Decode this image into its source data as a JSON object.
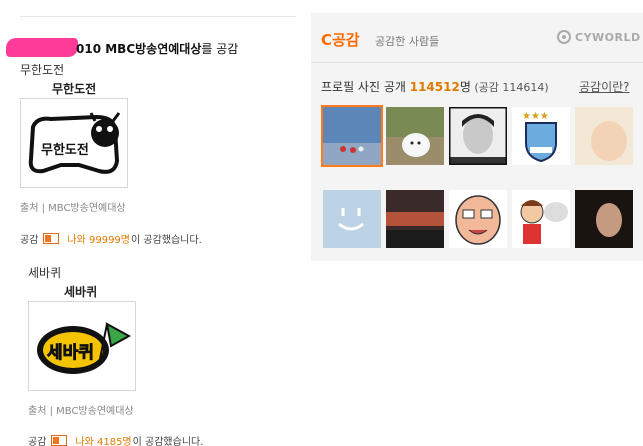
{
  "left": {
    "header_text": "010 MBC방송연예대상",
    "header_suffix": "를 공감",
    "items": [
      {
        "title": "무한도전",
        "thumb_title": "무한도전",
        "thumb_text": "무한도전",
        "source": "출처 | MBC방송연예대상",
        "empathy_label": "공감",
        "empathy_count": "나와 99999명",
        "empathy_suffix": "이 공감했습니다."
      },
      {
        "title": "세바퀴",
        "thumb_title": "세바퀴",
        "thumb_text": "세바퀴",
        "source": "출처 | MBC방송연예대상",
        "empathy_label": "공감",
        "empathy_count": "나와 4185명",
        "empathy_suffix": "이 공감했습니다."
      }
    ]
  },
  "right": {
    "title": "C공감",
    "subtitle": "공감한 사람들",
    "logo_text": "CYWORLD",
    "stats_prefix": "프로필 사진 공개 ",
    "stats_count": "114512",
    "stats_unit": "명",
    "stats_paren": " (공감 114614)",
    "help_link": "공감이란?",
    "photos": [
      "sky-beach-photo",
      "white-dog-photo",
      "man-portrait-photo",
      "man-city-crest-photo",
      "baby-photo",
      "smiley-face-photo",
      "sunset-sky-photo",
      "cartoon-face-photo",
      "cartoon-boy-photo",
      "dark-portrait-photo"
    ]
  },
  "colors": {
    "accent": "#ff6a00",
    "count": "#e07a00",
    "panel_bg": "#f4f4f4",
    "redact": "#ff3b9a"
  }
}
